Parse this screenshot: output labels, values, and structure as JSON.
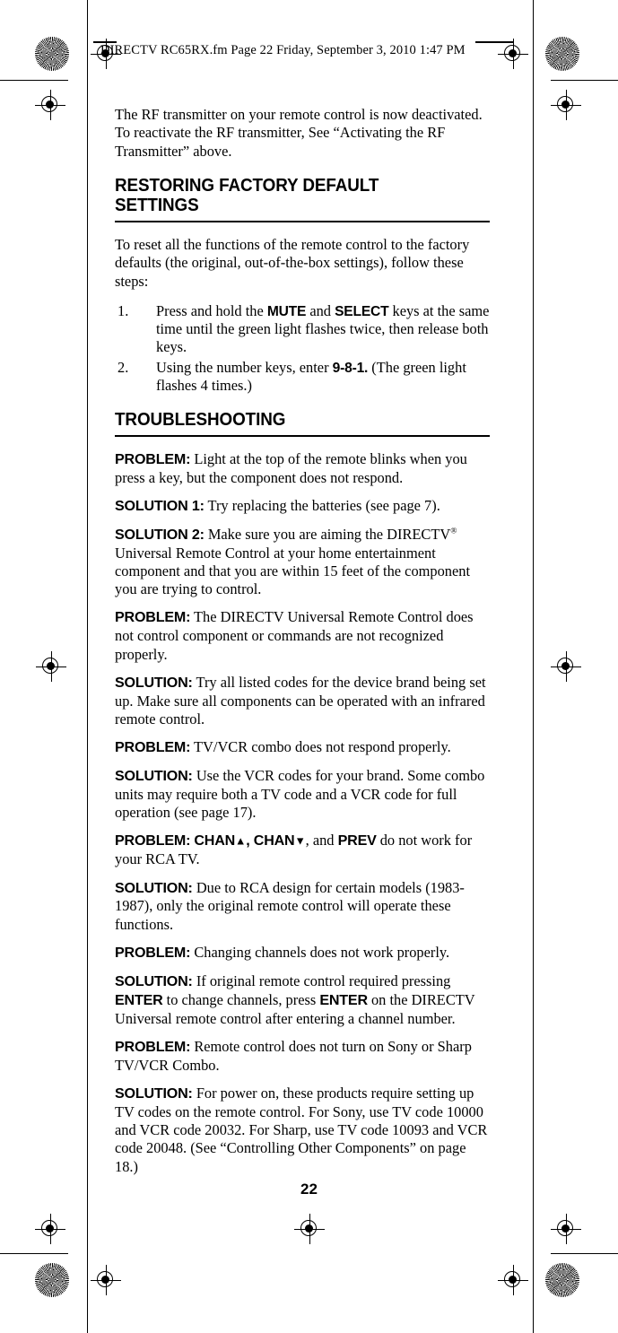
{
  "header": {
    "running_head": "DIRECTV RC65RX.fm  Page 22  Friday, September 3, 2010  1:47 PM"
  },
  "folio": {
    "page_number": "22"
  },
  "content": {
    "intro_paragraph": "The RF transmitter on your remote control is now deactivated. To reactivate the RF transmitter, See “Activating the RF Transmitter” above.",
    "section_restore": {
      "heading": "RESTORING FACTORY DEFAULT SETTINGS",
      "lead_paragraph": "To reset all the functions of the remote control to the factory defaults (the original, out-of-the-box settings), follow these steps:",
      "steps": [
        {
          "number": "1.",
          "part1": "Press and hold the ",
          "key1": "MUTE",
          "part2": " and ",
          "key2": "SELECT",
          "part3": " keys at the same time until the green light flashes twice, then release both keys."
        },
        {
          "number": "2.",
          "part1": "Using the number keys, enter ",
          "key1": "9-8-1.",
          "part2": " (The green light flashes 4 times.)"
        }
      ]
    },
    "section_troubleshooting": {
      "heading": "TROUBLESHOOTING",
      "entries": [
        {
          "label": "PROBLEM:",
          "text": " Light at the top of the remote blinks when you press a key, but the component does not respond."
        },
        {
          "label": "SOLUTION 1:",
          "text": " Try replacing the batteries (see page 7)."
        },
        {
          "label": "SOLUTION 2:",
          "text_before": "  Make sure you are aiming the DIRECTV",
          "trademark": "®",
          "text_after": " Universal Remote Control at your home entertainment component and that you are within 15 feet of the component you are trying to control."
        },
        {
          "label": "PROBLEM:",
          "text": " The DIRECTV Universal Remote Control does not control component or commands are not recognized properly."
        },
        {
          "label": "SOLUTION:",
          "text": " Try all listed codes for the device brand being set up. Make sure all components can be operated with an infrared remote control."
        },
        {
          "label": "PROBLEM:",
          "text": " TV/VCR combo does not respond properly."
        },
        {
          "label": "SOLUTION:",
          "text": " Use the VCR codes for your brand. Some combo units may require both a TV code and a VCR code for full operation (see page 17)."
        },
        {
          "label": "PROBLEM:",
          "key_chan_up": "CHAN",
          "glyph_up": "▲",
          "sep1": ", ",
          "key_chan_down": "CHAN",
          "glyph_down": "▼",
          "sep2": ", and ",
          "key_prev": "PREV",
          "text_after": " do not work for your RCA TV."
        },
        {
          "label": "SOLUTION:",
          "text": " Due to RCA design for certain models (1983-1987), only the original remote control will operate these functions."
        },
        {
          "label": "PROBLEM:",
          "text": " Changing channels does not work properly."
        },
        {
          "label": "SOLUTION:",
          "text_before": "  If original remote control required pressing ",
          "key1": "ENTER",
          "text_mid": " to change channels, press ",
          "key2": "ENTER",
          "text_after": " on the DIRECTV Universal remote control after entering a channel number."
        },
        {
          "label": "PROBLEM:",
          "text": " Remote control does not turn on Sony or Sharp TV/VCR Combo."
        },
        {
          "label": "SOLUTION:",
          "text": "  For power on, these products require setting up TV codes on the remote control. For Sony, use TV code 10000 and VCR code 20032. For Sharp, use TV code 10093 and VCR code 20048. (See “Controlling Other Components” on page 18.)"
        }
      ]
    }
  }
}
